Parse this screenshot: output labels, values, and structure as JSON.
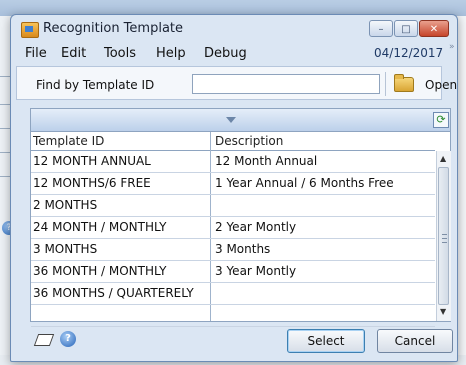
{
  "window": {
    "title": "Recognition Template",
    "controls": {
      "minimize": "–",
      "maximize": "□",
      "close": "✕"
    }
  },
  "menu": {
    "items": [
      "File",
      "Edit",
      "Tools",
      "Help",
      "Debug"
    ],
    "date": "04/12/2017",
    "overflow": "»"
  },
  "find": {
    "label": "Find by Template ID",
    "value": "",
    "open_label": "Open"
  },
  "grid": {
    "columns": [
      "Template ID",
      "Description"
    ],
    "rows": [
      {
        "id": "12 MONTH ANNUAL",
        "description": "12 Month Annual"
      },
      {
        "id": "12 MONTHS/6 FREE",
        "description": "1 Year Annual / 6 Months Free"
      },
      {
        "id": "2 MONTHS",
        "description": ""
      },
      {
        "id": "24 MONTH / MONTHLY",
        "description": "2 Year Montly"
      },
      {
        "id": "3 MONTHS",
        "description": "3 Months"
      },
      {
        "id": "36 MONTH / MONTHLY",
        "description": "3 Year Montly"
      },
      {
        "id": "36 MONTHS / QUARTERELY",
        "description": ""
      },
      {
        "id": "",
        "description": ""
      }
    ],
    "refresh_glyph": "⟳",
    "scroll_up": "▲",
    "scroll_down": "▼"
  },
  "buttons": {
    "select": "Select",
    "cancel": "Cancel"
  },
  "icons": {
    "help_glyph": "?"
  }
}
